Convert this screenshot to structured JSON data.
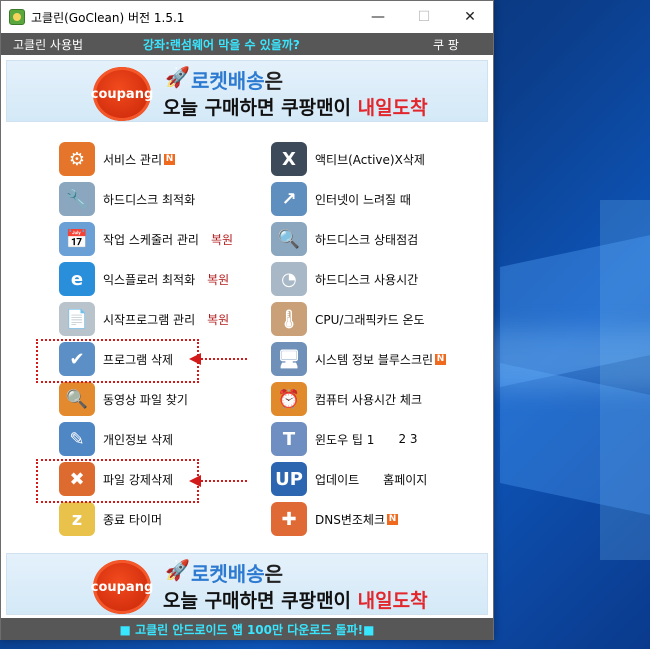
{
  "window": {
    "title": "고클린(GoClean) 버전 1.5.1",
    "minimize": "—",
    "maximize": "☐",
    "close": "✕"
  },
  "menubar": {
    "left": "고클린 사용법",
    "center": "강좌:랜섬웨어 막을 수 있을까?",
    "right": "쿠 팡"
  },
  "banner": {
    "badge": "coupang",
    "line1_hl": "로켓배송",
    "line1_rest": "은",
    "line2_pre": "오늘 구매하면 쿠팡맨이 ",
    "line2_hl": "내일도착"
  },
  "left_items": [
    {
      "label": "서비스 관리",
      "extra": "",
      "badge": "N",
      "icon": "gear-icon",
      "color": "#e4752a"
    },
    {
      "label": "하드디스크 최적화",
      "extra": "",
      "badge": "",
      "icon": "disk-wrench-icon",
      "color": "#8aa7bf"
    },
    {
      "label": "작업 스케줄러 관리",
      "extra": "복원",
      "badge": "",
      "icon": "scheduler-icon",
      "color": "#6aa0d6"
    },
    {
      "label": "익스플로러 최적화",
      "extra": "복원",
      "badge": "",
      "icon": "ie-icon",
      "color": "#2a8fdb"
    },
    {
      "label": "시작프로그램 관리",
      "extra": "복원",
      "badge": "",
      "icon": "document-icon",
      "color": "#b9c3cc"
    },
    {
      "label": "프로그램 삭제",
      "extra": "",
      "badge": "",
      "icon": "uninstall-icon",
      "color": "#5b8fc6"
    },
    {
      "label": "동영상 파일 찾기",
      "extra": "",
      "badge": "",
      "icon": "magnifier-icon",
      "color": "#e48a2e"
    },
    {
      "label": "개인정보 삭제",
      "extra": "",
      "badge": "",
      "icon": "privacy-icon",
      "color": "#4f86c4"
    },
    {
      "label": "파일 강제삭제",
      "extra": "",
      "badge": "",
      "icon": "force-delete-icon",
      "color": "#dd6b2f"
    },
    {
      "label": "종료 타이머",
      "extra": "",
      "badge": "",
      "icon": "timer-icon",
      "color": "#e8c24a"
    }
  ],
  "right_items": [
    {
      "label": "액티브(Active)X삭제",
      "extra": "",
      "badge": "",
      "icon": "activex-icon",
      "color": "#3d4a5a"
    },
    {
      "label": "인터넷이 느려질 때",
      "extra": "",
      "badge": "",
      "icon": "internet-icon",
      "color": "#5f8fbf"
    },
    {
      "label": "하드디스크 상태점검",
      "extra": "",
      "badge": "",
      "icon": "disk-check-icon",
      "color": "#8aa7bf"
    },
    {
      "label": "하드디스크 사용시간",
      "extra": "",
      "badge": "",
      "icon": "disk-time-icon",
      "color": "#a9b8c6"
    },
    {
      "label": "CPU/그래픽카드 온도",
      "extra": "",
      "badge": "",
      "icon": "thermometer-icon",
      "color": "#c9a078"
    },
    {
      "label": "시스템 정보 블루스크린",
      "extra": "",
      "badge": "N",
      "icon": "system-info-icon",
      "color": "#6f90b8"
    },
    {
      "label": "컴퓨터 사용시간 체크",
      "extra": "",
      "badge": "",
      "icon": "clock-icon",
      "color": "#e08a2c"
    },
    {
      "label": "윈도우 팁 1",
      "extra": "2    3",
      "badge": "",
      "icon": "tip-icon",
      "color": "#6f8fc2"
    },
    {
      "label": "업데이트",
      "extra": "홈페이지",
      "badge": "",
      "icon": "update-icon",
      "color": "#2d66b0"
    },
    {
      "label": "DNS변조체크",
      "extra": "",
      "badge": "N",
      "icon": "shield-icon",
      "color": "#e06a36"
    }
  ],
  "bottom_banner": {
    "badge": "coupang",
    "line1_hl": "로켓배송",
    "line1_rest": "은",
    "line2_pre": "오늘 구매하면 쿠팡맨이 ",
    "line2_hl": "내일도착"
  },
  "footer": "■ 고클린 안드로이드 앱 100만 다운로드 돌파!■"
}
